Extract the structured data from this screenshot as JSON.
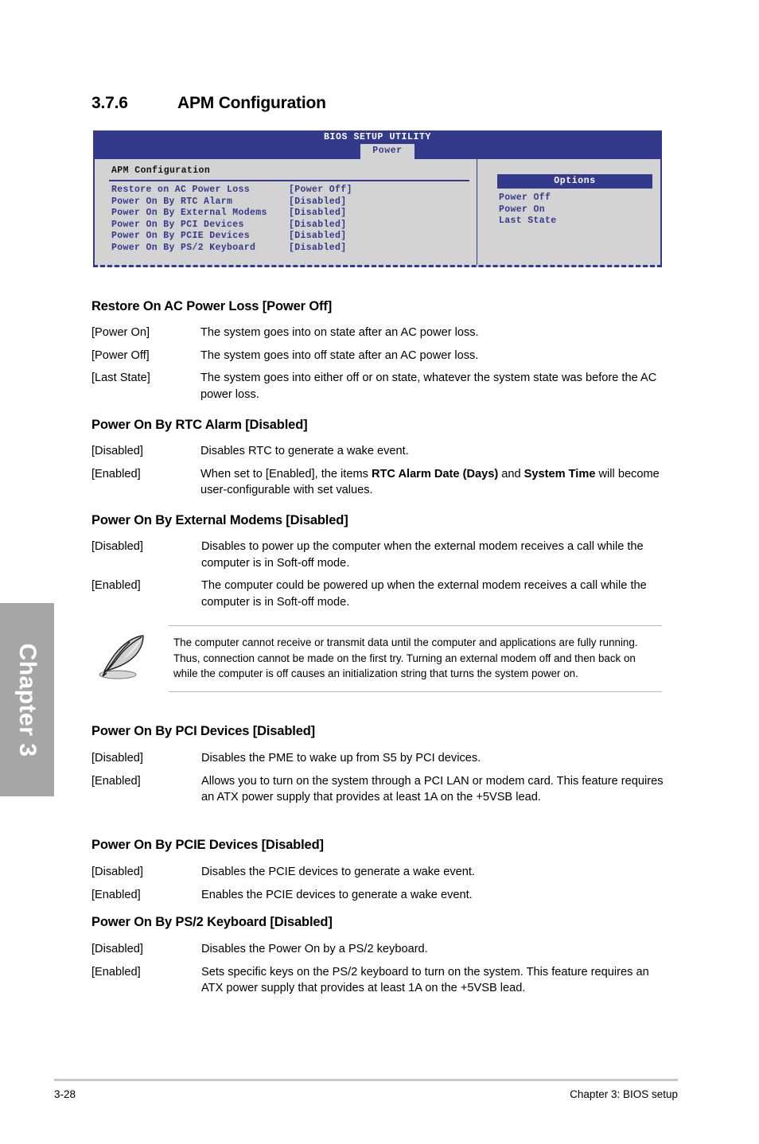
{
  "section": {
    "number": "3.7.6",
    "title": "APM Configuration"
  },
  "bios": {
    "utility_title": "BIOS SETUP UTILITY",
    "active_tab": "Power",
    "panel_title": "APM Configuration",
    "items": [
      {
        "label": "Restore on AC Power Loss",
        "value": "[Power Off]"
      },
      {
        "label": "Power On By RTC Alarm",
        "value": "[Disabled]"
      },
      {
        "label": "Power On By External Modems",
        "value": "[Disabled]"
      },
      {
        "label": "Power On By PCI Devices",
        "value": "[Disabled]"
      },
      {
        "label": "Power On By PCIE Devices",
        "value": "[Disabled]"
      },
      {
        "label": "Power On By PS/2 Keyboard",
        "value": "[Disabled]"
      }
    ],
    "options_header": "Options",
    "options": [
      "Power Off",
      "Power On",
      "Last State"
    ],
    "colors": {
      "blue": "#333a8c",
      "panel_gray": "#d3d3d3"
    }
  },
  "sections": {
    "restore_ac": {
      "heading": "Restore On AC Power Loss [Power Off]",
      "rows": [
        {
          "term": "[Power On]",
          "desc": "The system goes into on state after an AC power loss."
        },
        {
          "term": "[Power Off]",
          "desc": "The system goes into off state after an AC power loss."
        },
        {
          "term": "[Last State]",
          "desc": "The system goes into either off or on state, whatever the system state was before the AC power loss."
        }
      ]
    },
    "rtc_alarm": {
      "heading": "Power On By RTC Alarm [Disabled]",
      "rows": [
        {
          "term": "[Disabled]",
          "desc": "Disables RTC to generate a wake event."
        },
        {
          "term": "[Enabled]",
          "desc_pre": "When set to [Enabled], the items ",
          "desc_bold1": "RTC Alarm Date (Days)",
          "desc_mid": " and ",
          "desc_bold2": "System Time",
          "desc_post": " will become user-configurable with set values."
        }
      ]
    },
    "external_modems": {
      "heading": "Power On By External Modems [Disabled]",
      "rows": [
        {
          "term": "[Disabled]",
          "desc": "Disables to power up the computer when the external modem receives a call while the computer is in Soft-off mode."
        },
        {
          "term": "[Enabled]",
          "desc": "The computer could be powered up when the external modem receives a call while the computer is in Soft-off mode."
        }
      ]
    },
    "note": {
      "icon": "quill-pen-icon",
      "text": "The computer cannot receive or transmit data until the computer and applications are fully running. Thus, connection cannot be made on the first try. Turning an external modem off and then back on while the computer is off causes an initialization string that turns the system power on."
    },
    "pci_devices": {
      "heading": "Power On By PCI Devices [Disabled]",
      "rows": [
        {
          "term": "[Disabled]",
          "desc": "Disables the PME to wake up from S5 by PCI devices."
        },
        {
          "term": "[Enabled]",
          "desc": "Allows you to turn on the system through a PCI LAN or modem card. This feature requires an ATX power supply that provides at least 1A on the +5VSB lead."
        }
      ]
    },
    "pcie_devices": {
      "heading": "Power On By PCIE Devices [Disabled]",
      "rows": [
        {
          "term": "[Disabled]",
          "desc": "Disables the PCIE devices to generate a wake event."
        },
        {
          "term": "[Enabled]",
          "desc": "Enables the PCIE devices to generate a wake event."
        }
      ]
    },
    "ps2_keyboard": {
      "heading": "Power On By PS/2 Keyboard [Disabled]",
      "rows": [
        {
          "term": "[Disabled]",
          "desc": "Disables the Power On by a PS/2 keyboard."
        },
        {
          "term": "[Enabled]",
          "desc": "Sets specific keys on the PS/2 keyboard to turn on the system. This feature requires an ATX power supply that provides at least 1A on the +5VSB lead."
        }
      ]
    }
  },
  "chapter_tab": {
    "label": "Chapter 3"
  },
  "footer": {
    "page_number": "3-28",
    "chapter_title": "Chapter 3: BIOS setup"
  }
}
